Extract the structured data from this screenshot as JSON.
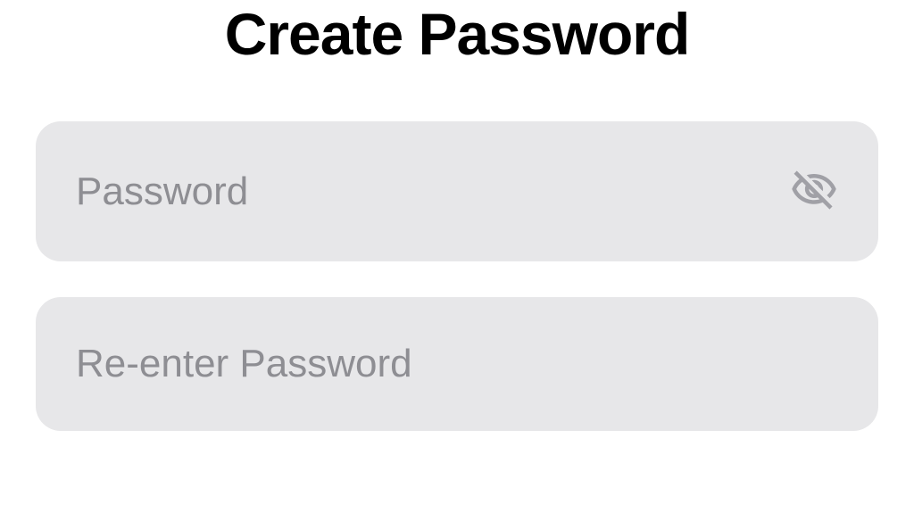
{
  "header": {
    "title": "Create Password"
  },
  "form": {
    "password": {
      "placeholder": "Password",
      "value": ""
    },
    "confirm_password": {
      "placeholder": "Re-enter Password",
      "value": ""
    }
  }
}
